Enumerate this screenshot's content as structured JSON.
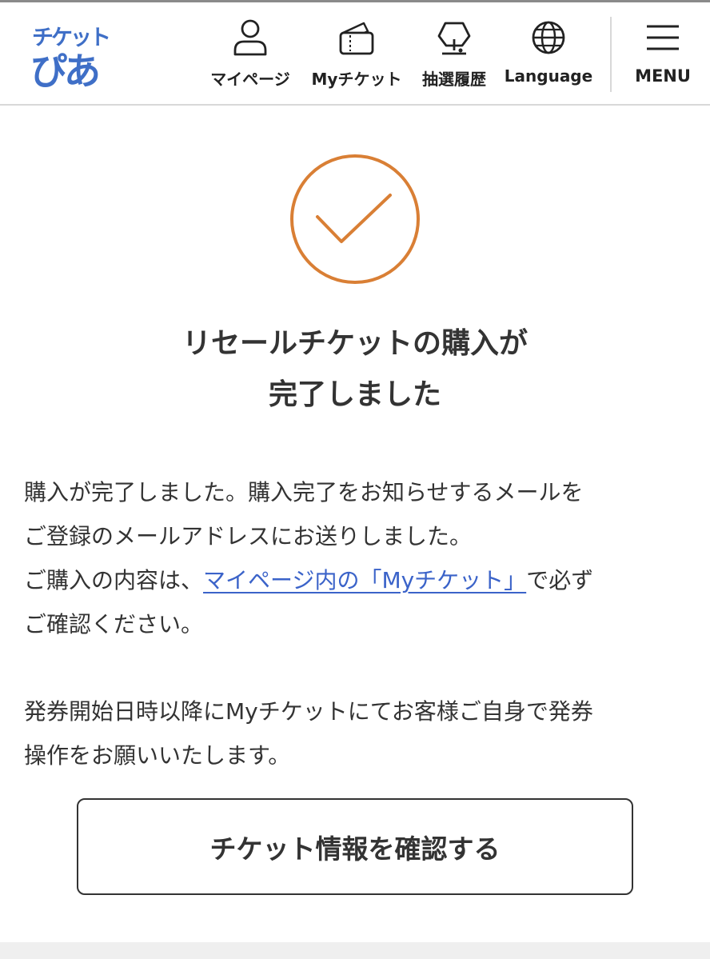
{
  "header": {
    "logo": {
      "top": "チケット",
      "bottom": "ぴあ"
    },
    "nav": [
      {
        "label": "マイページ",
        "icon": "person-icon"
      },
      {
        "label": "Myチケット",
        "icon": "ticket-icon"
      },
      {
        "label": "抽選履歴",
        "icon": "lottery-icon"
      },
      {
        "label": "Language",
        "icon": "globe-icon"
      }
    ],
    "menu_label": "MENU"
  },
  "main": {
    "check_color": "#d97f35",
    "title_line1": "リセールチケットの購入が",
    "title_line2": "完了しました",
    "paragraph1_line1": "購入が完了しました。購入完了をお知らせするメールを",
    "paragraph1_line2": "ご登録のメールアドレスにお送りしました。",
    "paragraph1_line3_before": "ご購入の内容は、",
    "paragraph1_link": "マイページ内の「Myチケット」",
    "paragraph1_line3_after": "で必ず",
    "paragraph1_line4": "ご確認ください。",
    "paragraph2_line1": "発券開始日時以降にMyチケットにてお客様ご自身で発券",
    "paragraph2_line2": "操作をお願いいたします。",
    "button_label": "チケット情報を確認する"
  },
  "colors": {
    "brand": "#3f6fc7",
    "link": "#3b63c9",
    "accent": "#d97f35"
  }
}
